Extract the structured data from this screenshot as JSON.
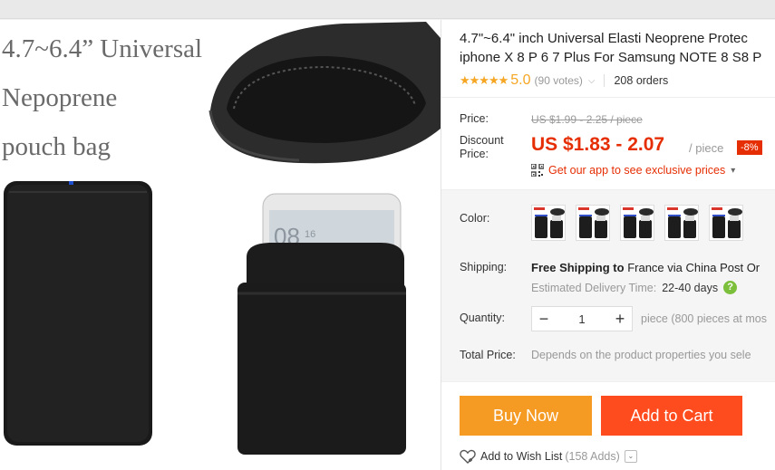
{
  "product": {
    "title_line1": "4.7\"~6.4\" inch Universal Elasti Neoprene Protec",
    "title_line2": "iphone X 8 P 6 7 Plus For Samsung NOTE 8 S8 P",
    "stars": "★★★★★",
    "rating": "5.0",
    "votes": "(90 votes)",
    "orders": "208 orders"
  },
  "gallery": {
    "line1": "4.7~6.4” Universal",
    "line2": "Nepoprene",
    "line3": "pouch bag",
    "phone_time": "08",
    "phone_time_small": "16"
  },
  "price": {
    "label": "Price:",
    "original": "US $1.99 - 2.25 / piece",
    "discount_label_line1": "Discount",
    "discount_label_line2": "Price:",
    "current": "US $1.83 - 2.07",
    "unit": "/ piece",
    "discount_badge": "-8%",
    "app_promo": "Get our app to see exclusive prices",
    "app_promo_caret": "▾"
  },
  "color": {
    "label": "Color:",
    "thumb_count": 5
  },
  "shipping": {
    "label": "Shipping:",
    "free_label": "Free Shipping to",
    "destination": "France via China Post Or",
    "delivery_label": "Estimated Delivery Time:",
    "delivery_days": "22-40 days",
    "help": "?"
  },
  "quantity": {
    "label": "Quantity:",
    "minus": "−",
    "value": "1",
    "plus": "+",
    "note": "piece (800 pieces at mos"
  },
  "total": {
    "label": "Total Price:",
    "note": "Depends on the product properties you sele"
  },
  "actions": {
    "buy_now": "Buy Now",
    "add_to_cart": "Add to Cart",
    "wish_label": "Add to Wish List",
    "wish_count": "(158 Adds)",
    "wish_caret": "⌄"
  },
  "colors": {
    "accent_red": "#e62e04",
    "buy_orange": "#f59a23",
    "cart_red": "#ff4c1e",
    "star_gold": "#f5a623"
  }
}
